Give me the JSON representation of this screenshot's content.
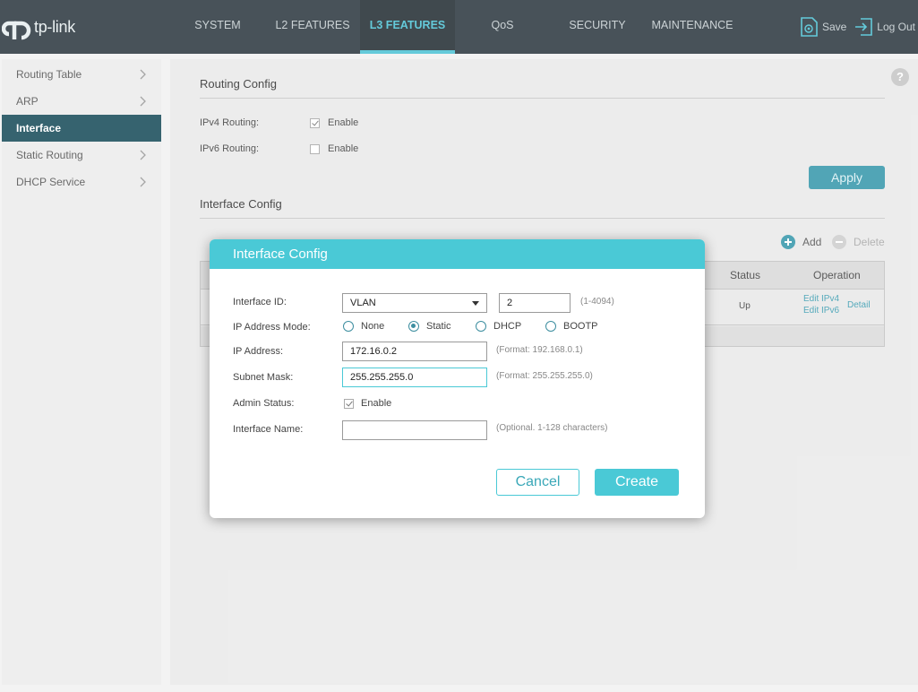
{
  "brand": {
    "logo_text": "tp-link"
  },
  "nav": {
    "items": [
      "SYSTEM",
      "L2 FEATURES",
      "L3 FEATURES",
      "QoS",
      "SECURITY",
      "MAINTENANCE"
    ],
    "active": "L3 FEATURES"
  },
  "top_actions": {
    "save": "Save",
    "logout": "Log Out"
  },
  "sidebar": {
    "items": [
      {
        "label": "Routing Table"
      },
      {
        "label": "ARP"
      },
      {
        "label": "Interface"
      },
      {
        "label": "Static Routing"
      },
      {
        "label": "DHCP Service"
      }
    ],
    "active": "Interface"
  },
  "routing_config": {
    "title": "Routing Config",
    "ipv4_label": "IPv4 Routing:",
    "ipv4_enable": "Enable",
    "ipv4_checked": true,
    "ipv6_label": "IPv6 Routing:",
    "ipv6_enable": "Enable",
    "ipv6_checked": false,
    "apply": "Apply"
  },
  "interface_config": {
    "title": "Interface Config",
    "add": "Add",
    "delete": "Delete",
    "columns": {
      "status": "Status",
      "operation": "Operation"
    },
    "row": {
      "status": "Up",
      "edit_ipv4": "Edit IPv4",
      "edit_ipv6": "Edit IPv6",
      "detail": "Detail"
    }
  },
  "modal": {
    "title": "Interface Config",
    "interface_id_label": "Interface ID:",
    "interface_type": "VLAN",
    "interface_id_value": "2",
    "interface_id_hint": "(1-4094)",
    "ip_mode_label": "IP Address Mode:",
    "ip_modes": [
      "None",
      "Static",
      "DHCP",
      "BOOTP"
    ],
    "ip_mode_selected": "Static",
    "ip_address_label": "IP Address:",
    "ip_address_value": "172.16.0.2",
    "ip_address_hint": "(Format: 192.168.0.1)",
    "subnet_label": "Subnet Mask:",
    "subnet_value": "255.255.255.0",
    "subnet_hint": "(Format: 255.255.255.0)",
    "admin_status_label": "Admin Status:",
    "admin_status_enable": "Enable",
    "admin_status_checked": true,
    "interface_name_label": "Interface Name:",
    "interface_name_value": "",
    "interface_name_hint": "(Optional. 1-128 characters)",
    "cancel": "Cancel",
    "create": "Create"
  },
  "colors": {
    "accent": "#4ac9d6",
    "header_bg": "#2f3b42",
    "sidebar_active": "#1b4e5c",
    "apply_bg": "#3a99ac"
  }
}
